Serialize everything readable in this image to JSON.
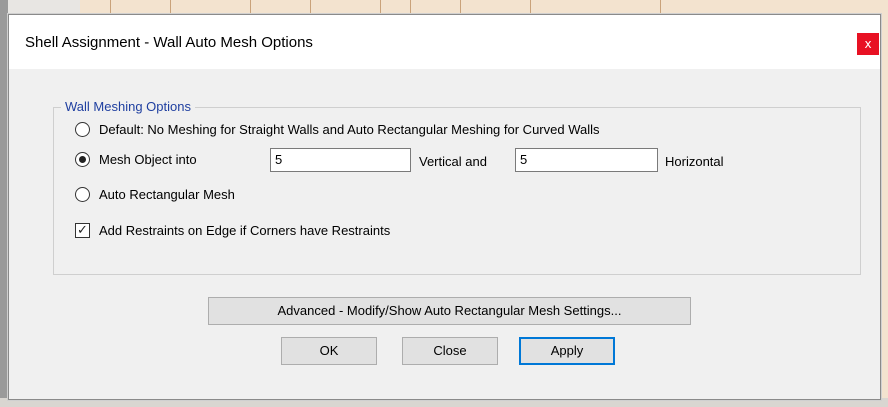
{
  "dialog": {
    "title": "Shell Assignment - Wall Auto Mesh Options",
    "close_glyph": "x"
  },
  "group": {
    "legend": "Wall Meshing Options",
    "options": [
      {
        "type": "radio",
        "checked": false,
        "label": "Default:  No Meshing for Straight Walls and Auto Rectangular Meshing for Curved Walls"
      },
      {
        "type": "radio",
        "checked": true,
        "label": "Mesh Object into"
      },
      {
        "type": "radio",
        "checked": false,
        "label": "Auto Rectangular Mesh"
      },
      {
        "type": "checkbox",
        "checked": true,
        "label": "Add Restraints on Edge if Corners have Restraints"
      }
    ],
    "vertical_value": "5",
    "vertical_label": "Vertical  and",
    "horizontal_value": "5",
    "horizontal_label": "Horizontal"
  },
  "buttons": {
    "advanced": "Advanced - Modify/Show Auto Rectangular Mesh Settings...",
    "ok": "OK",
    "close": "Close",
    "apply": "Apply"
  },
  "colors": {
    "legend": "#1f3fa0",
    "close_button": "#e81123",
    "default_button_border": "#0078d7"
  },
  "icons": {
    "checkmark": "✓"
  }
}
